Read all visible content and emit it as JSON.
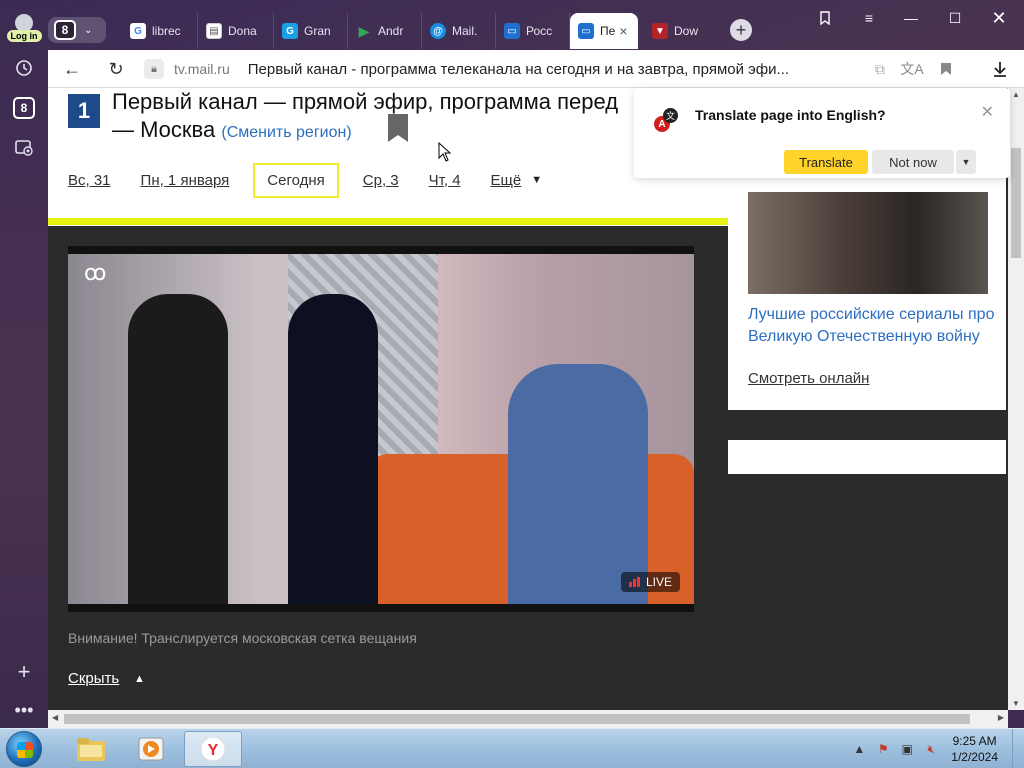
{
  "sidebar": {
    "login_label": "Log in",
    "badge_count": "8",
    "items": [
      {
        "icon": "history-icon"
      },
      {
        "icon": "yandex-8-icon"
      },
      {
        "icon": "screenshot-icon"
      }
    ],
    "bottom": [
      {
        "icon": "plus-icon"
      },
      {
        "icon": "more-icon"
      }
    ]
  },
  "tabbar": {
    "tab_count": "8",
    "tabs": [
      {
        "label": "librec",
        "favicon": "google-icon",
        "color": "#ffffff"
      },
      {
        "label": "Dona",
        "favicon": "document-icon",
        "color": "#ffffff"
      },
      {
        "label": "Gran",
        "favicon": "grand-icon",
        "color": "#1aa1e5"
      },
      {
        "label": "Andr",
        "favicon": "play-store-icon",
        "color": "#34a853"
      },
      {
        "label": "Mail.",
        "favicon": "mail-at-icon",
        "color": "#168de2"
      },
      {
        "label": "Росс",
        "favicon": "tv-icon",
        "color": "#1f6fd1"
      },
      {
        "label": "Пе",
        "favicon": "tv-icon",
        "color": "#1f6fd1",
        "active": true
      },
      {
        "label": "Dow",
        "favicon": "download-site-icon",
        "color": "#b5232a"
      }
    ]
  },
  "toolbar": {
    "domain": "tv.mail.ru",
    "title": "Первый канал - программа телеканала на сегодня и на завтра, прямой эфи..."
  },
  "page": {
    "logo_char": "1",
    "title": "Первый канал — прямой эфир, программа перед",
    "title_line2": "— Москва",
    "change_region": "(Сменить регион)",
    "days": [
      {
        "label": "Вс, 31"
      },
      {
        "label": "Пн, 1 января"
      },
      {
        "label": "Сегодня",
        "selected": true
      },
      {
        "label": "Ср, 3"
      },
      {
        "label": "Чт, 4"
      },
      {
        "label": "Ещё"
      }
    ],
    "live_label": "LIVE",
    "notice": "Внимание! Транслируется московская сетка вещания",
    "hide_link": "Скрыть"
  },
  "side": {
    "card_title": "Лучшие российские сериалы про Великую Отечественную войну",
    "card_link": "Смотреть онлайн"
  },
  "translate_popup": {
    "title": "Translate page into English?",
    "translate_btn": "Translate",
    "not_now_btn": "Not now"
  },
  "taskbar": {
    "time": "9:25 AM",
    "date": "1/2/2024"
  },
  "colors": {
    "accent_yellow": "#e8f212",
    "link_blue": "#2c6fbf",
    "translate_yellow": "#fed42b"
  }
}
